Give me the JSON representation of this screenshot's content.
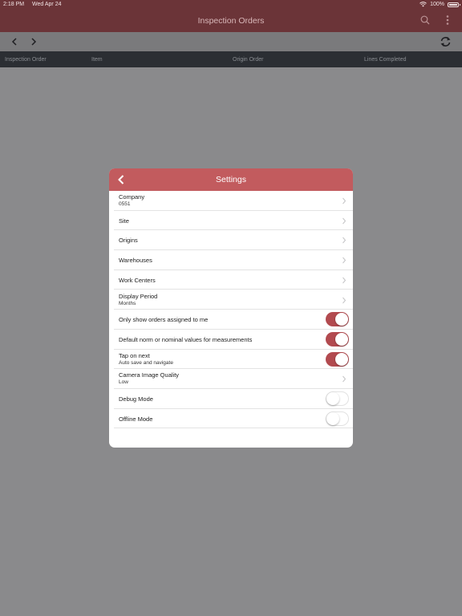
{
  "status_bar": {
    "time": "2:18 PM",
    "date": "Wed Apr 24",
    "battery": "100%",
    "icons": [
      "wifi-icon",
      "battery-icon"
    ]
  },
  "navbar": {
    "title": "Inspection Orders",
    "icons": [
      "search-icon",
      "more-vertical-icon"
    ]
  },
  "toolbar": {
    "icons": [
      "chevron-left-icon",
      "chevron-right-icon",
      "refresh-icon"
    ]
  },
  "columns": [
    "Inspection Order",
    "Item",
    "Origin Order",
    "Lines Completed"
  ],
  "settings": {
    "title": "Settings",
    "rows": [
      {
        "label": "Company",
        "value": "0551",
        "control": "chevron"
      },
      {
        "label": "Site",
        "control": "chevron"
      },
      {
        "label": "Origins",
        "control": "chevron"
      },
      {
        "label": "Warehouses",
        "control": "chevron"
      },
      {
        "label": "Work Centers",
        "control": "chevron"
      },
      {
        "label": "Display Period",
        "value": "Months",
        "control": "chevron"
      },
      {
        "label": "Only show orders assigned to me",
        "control": "toggle",
        "on": true
      },
      {
        "label": "Default norm or nominal values for measurements",
        "control": "toggle",
        "on": true
      },
      {
        "label": "Tap on next",
        "value": "Auto save and navigate",
        "control": "toggle",
        "on": true
      },
      {
        "label": "Camera Image Quality",
        "value": "Low",
        "control": "chevron"
      },
      {
        "label": "Debug Mode",
        "control": "toggle",
        "on": false
      },
      {
        "label": "Offline Mode",
        "control": "toggle",
        "on": false
      }
    ]
  },
  "colors": {
    "brand_dark": "#6b3438",
    "header_red": "#c25b5e",
    "toggle_on": "#b24a4f",
    "overlay": "#8a8a8c"
  }
}
